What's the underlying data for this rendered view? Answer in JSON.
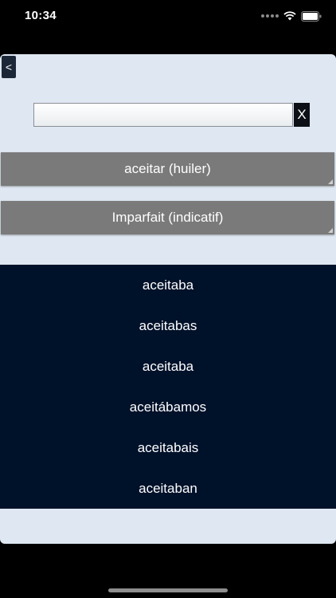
{
  "status_bar": {
    "time": "10:34",
    "icons": [
      "signal-icon",
      "wifi-icon",
      "battery-icon"
    ]
  },
  "nav": {
    "back_label": "<"
  },
  "search": {
    "value": "",
    "placeholder": "",
    "clear_label": "X"
  },
  "verb_selector": {
    "label": "aceitar (huiler)"
  },
  "tense_selector": {
    "label": "Imparfait (indicatif)"
  },
  "conjugations": [
    "aceitaba",
    "aceitabas",
    "aceitaba",
    "aceitábamos",
    "aceitabais",
    "aceitaban"
  ],
  "colors": {
    "background": "#000000",
    "card": "#dfe7f2",
    "selector_button": "#7a7a7a",
    "conjugation_panel": "#00112a",
    "text_light": "#ffffff"
  }
}
